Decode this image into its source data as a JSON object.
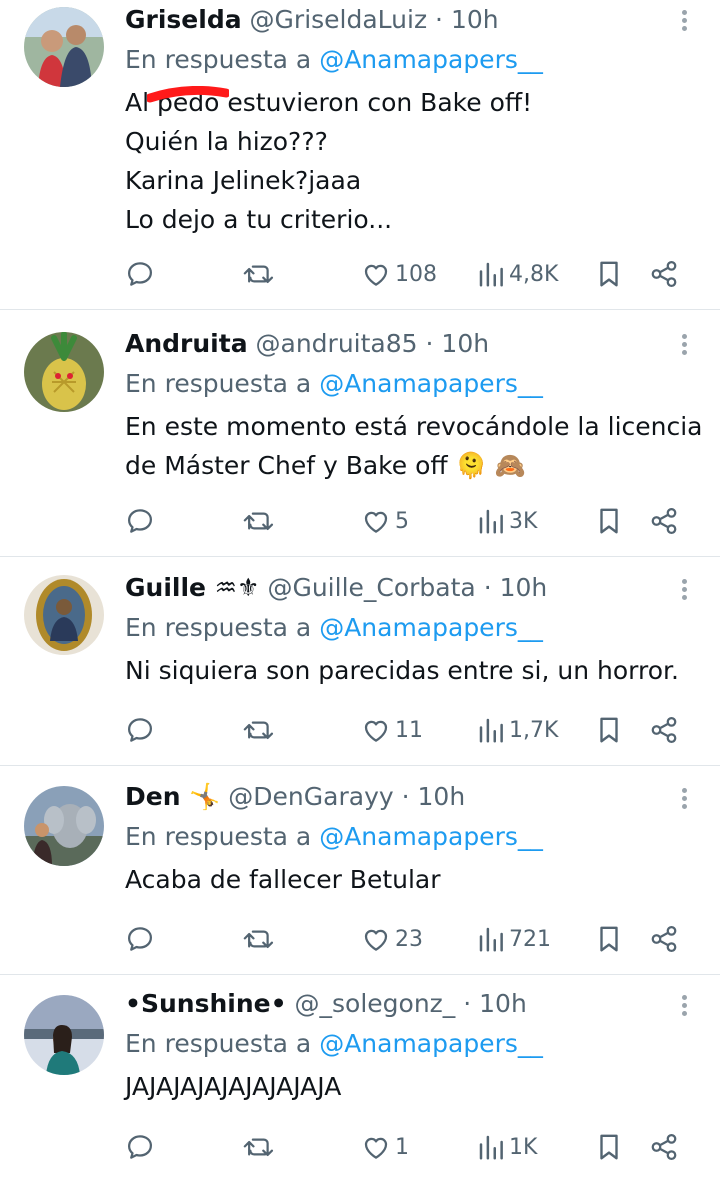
{
  "mention_prefix": "En respuesta a",
  "tweets": [
    {
      "name": "Griselda",
      "handle": "@GriseldaLuiz",
      "time": "· 10h",
      "reply_to": "@Anamapapers__",
      "lines": [
        "Al pedo estuvieron con Bake off!",
        "Quién la hizo???",
        "Karina Jelinek?jaaa",
        "Lo dejo a tu criterio..."
      ],
      "likes": "108",
      "views": "4,8K"
    },
    {
      "name": "Andruita",
      "handle": "@andruita85",
      "time": "· 10h",
      "reply_to": "@Anamapapers__",
      "lines": [
        "En este momento está revocándole la licencia",
        "de Máster Chef y Bake off 🫠 🙈"
      ],
      "likes": "5",
      "views": "3K"
    },
    {
      "name": "Guille ♒⚜",
      "handle": "@Guille_Corbata",
      "time": "· 10h",
      "reply_to": "@Anamapapers__",
      "lines": [
        "Ni siquiera son parecidas entre si, un horror."
      ],
      "likes": "11",
      "views": "1,7K"
    },
    {
      "name": "Den 🤸",
      "handle": "@DenGarayy",
      "time": "· 10h",
      "reply_to": "@Anamapapers__",
      "lines": [
        "Acaba de fallecer Betular"
      ],
      "likes": "23",
      "views": "721"
    },
    {
      "name": "•Sunshine•",
      "handle": "@_solegonz_",
      "time": "· 10h",
      "reply_to": "@Anamapapers__",
      "lines": [
        "JAJAJAJAJAJAJAJAJA"
      ],
      "likes": "1",
      "views": "1K"
    }
  ],
  "icons": [
    "reply-icon",
    "retweet-icon",
    "like-icon",
    "views-icon",
    "bookmark-icon",
    "share-icon",
    "more-icon"
  ],
  "colors": {
    "text": "#0f1419",
    "muted": "#536471",
    "link": "#1d9bf0",
    "divider": "#e1e6ea",
    "redaction": "#ff1a1a"
  }
}
